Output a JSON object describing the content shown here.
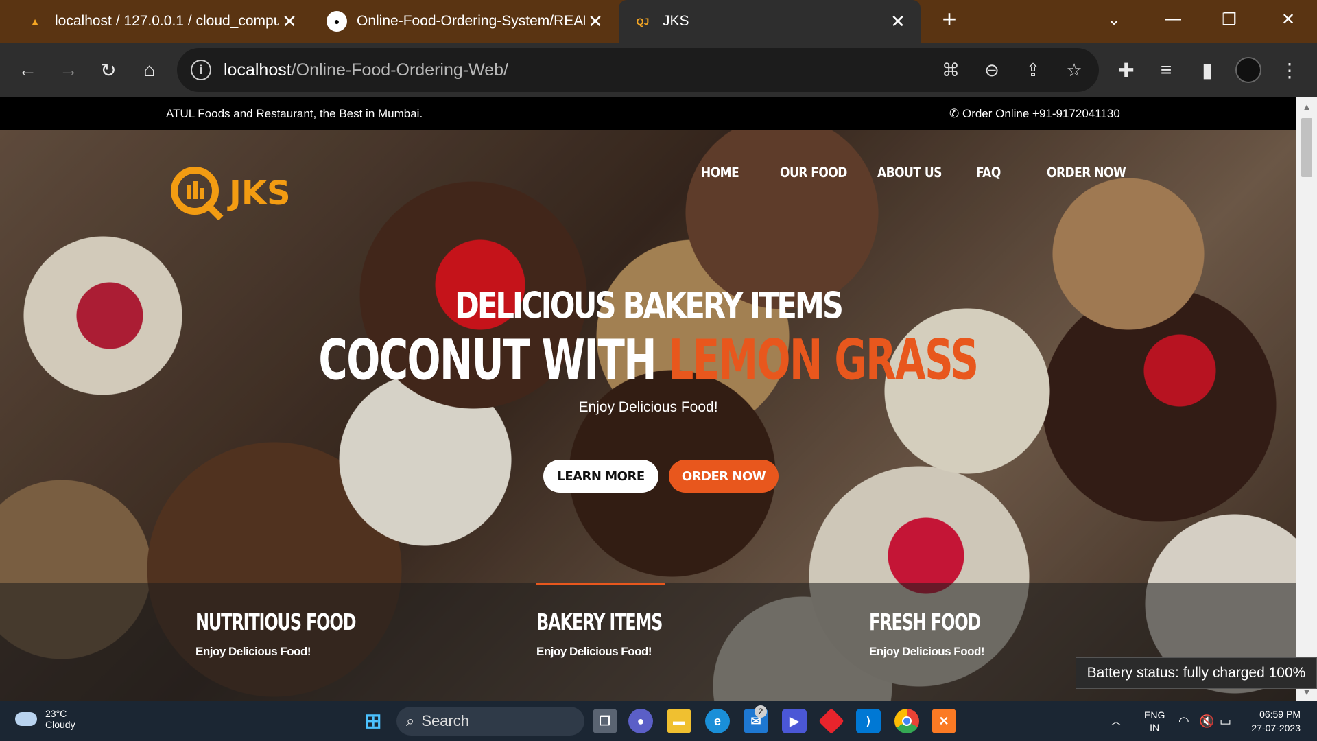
{
  "browser": {
    "tabs": [
      {
        "title": "localhost / 127.0.0.1 / cloud_comput",
        "favicon": "pma-icon"
      },
      {
        "title": "Online-Food-Ordering-System/REAI",
        "favicon": "github-icon"
      },
      {
        "title": "JKS",
        "favicon": "jks-icon",
        "active": true
      }
    ],
    "new_tab": "+",
    "address": {
      "host": "localhost",
      "path": "/Online-Food-Ordering-Web/"
    }
  },
  "site": {
    "topbar_left": "ATUL Foods and Restaurant, the Best in Mumbai.",
    "topbar_right": "Order Online +91-9172041130",
    "logo_text": "JKS",
    "nav": [
      "HOME",
      "OUR FOOD",
      "ABOUT US",
      "FAQ",
      "ORDER NOW"
    ],
    "hero": {
      "subtitle": "DELICIOUS BAKERY ITEMS",
      "title_a": "COCONUT WITH ",
      "title_b": "LEMON GRASS",
      "tagline": "Enjoy Delicious Food!",
      "btn_learn": "LEARN MORE",
      "btn_order": "ORDER NOW"
    },
    "features": [
      {
        "title": "NUTRITIOUS FOOD",
        "text": "Enjoy Delicious Food!"
      },
      {
        "title": "BAKERY ITEMS",
        "text": "Enjoy Delicious Food!"
      },
      {
        "title": "FRESH FOOD",
        "text": "Enjoy Delicious Food!"
      }
    ],
    "accent_color": "#e8571d"
  },
  "tooltip": "Battery status: fully charged 100%",
  "taskbar": {
    "weather_temp": "23°C",
    "weather_desc": "Cloudy",
    "search": "Search",
    "mail_badge": "2",
    "lang_1": "ENG",
    "lang_2": "IN",
    "time": "06:59 PM",
    "date": "27-07-2023"
  }
}
